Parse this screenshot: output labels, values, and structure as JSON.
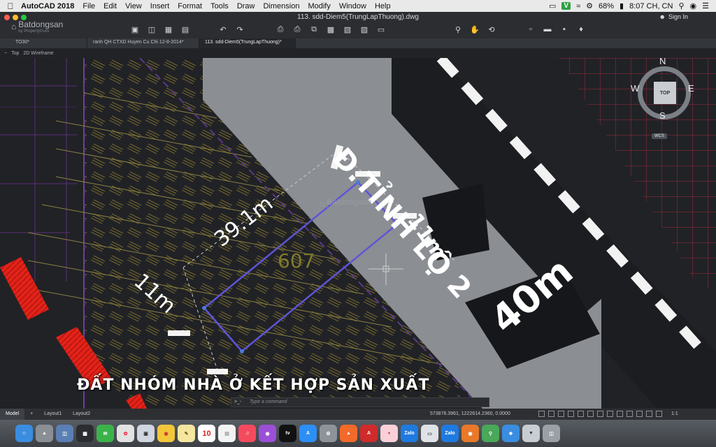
{
  "menubar": {
    "app_name": "AutoCAD 2018",
    "menus": [
      "File",
      "Edit",
      "View",
      "Insert",
      "Format",
      "Tools",
      "Draw",
      "Dimension",
      "Modify",
      "Window",
      "Help"
    ],
    "battery": "68%",
    "clock": "8:07 CH, CN",
    "v_badge": "V"
  },
  "window": {
    "title": "113. sdd-Diem5(TrungLapThuong).dwg",
    "sign_in": "Sign In"
  },
  "tabs": [
    {
      "label": "TO30*"
    },
    {
      "label": "ranh QH CTXD Huyen Cu Chi 12-8-2014*"
    },
    {
      "label": "113. sdd-Diem5(TrungLapThuong)*"
    }
  ],
  "viewport": {
    "view_label": "Top",
    "style_label": "2D Wireframe"
  },
  "drawing": {
    "street_name": "Đ.TỈNH LỘ 2",
    "road_width": "40m",
    "frontage": "11m",
    "depth": "39.1m",
    "back_width": "11m",
    "lot_number": "607",
    "caption": "ĐẤT NHÓM NHÀ Ở KẾT HỢP SẢN XUẤT"
  },
  "watermark": {
    "brand": "Batdongsan",
    "domain": ".com.vn",
    "sub": "by PropertyGuru"
  },
  "compass": {
    "north": "N",
    "south": "S",
    "east": "E",
    "west": "W",
    "cube": "TOP",
    "wcs": "WCS"
  },
  "command": {
    "placeholder": "Type a command",
    "prompt": ">_-"
  },
  "statusbar": {
    "tabs": [
      "Model",
      "Layout1",
      "Layout2"
    ],
    "coordinates": "573876.3961, 1222614.2360, 0.0000",
    "scale": "1:1"
  },
  "dock": {
    "calendar_day": "10",
    "apps": [
      "finder",
      "launchpad",
      "preferences",
      "messages",
      "photos",
      "preview",
      "chrome",
      "notes",
      "calendar",
      "stickies",
      "music",
      "podcasts",
      "tv",
      "app-store",
      "system-prefs",
      "brave",
      "autocad",
      "reader",
      "zalo",
      "screenshot",
      "firefox",
      "maps",
      "safari",
      "finder-window",
      "files",
      "trash"
    ]
  }
}
